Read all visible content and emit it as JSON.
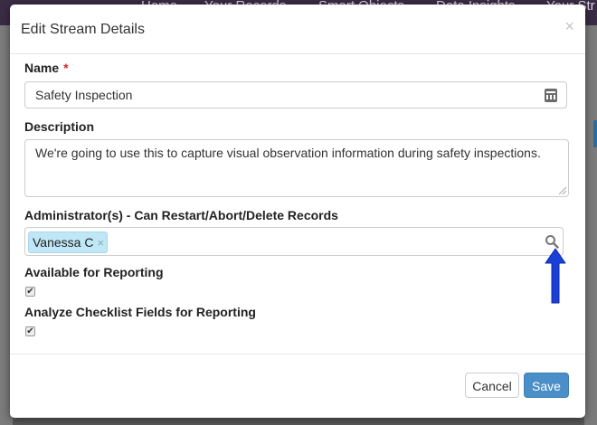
{
  "background_nav": {
    "items": [
      "Home",
      "Your Records",
      "Smart Objects",
      "Data Insights",
      "Your Str"
    ]
  },
  "modal": {
    "title": "Edit Stream Details",
    "close_glyph": "×",
    "name": {
      "label": "Name",
      "required_marker": "*",
      "value": "Safety Inspection"
    },
    "description": {
      "label": "Description",
      "value": "We're going to use this to capture visual observation information during safety inspections."
    },
    "administrators": {
      "label": "Administrator(s) - Can Restart/Abort/Delete Records",
      "tags": [
        {
          "label": "Vanessa C",
          "remove_glyph": "×"
        }
      ]
    },
    "available_for_reporting": {
      "label": "Available for Reporting",
      "checked": true,
      "check_glyph": "✔"
    },
    "analyze_checklist": {
      "label": "Analyze Checklist Fields for Reporting",
      "checked": true,
      "check_glyph": "✔"
    },
    "footer": {
      "cancel_label": "Cancel",
      "save_label": "Save"
    }
  },
  "colors": {
    "accent_blue": "#4a8fc7",
    "tag_bg": "#bfe7f5",
    "required_red": "#d9252c",
    "annotation_arrow": "#1a3fd9"
  }
}
